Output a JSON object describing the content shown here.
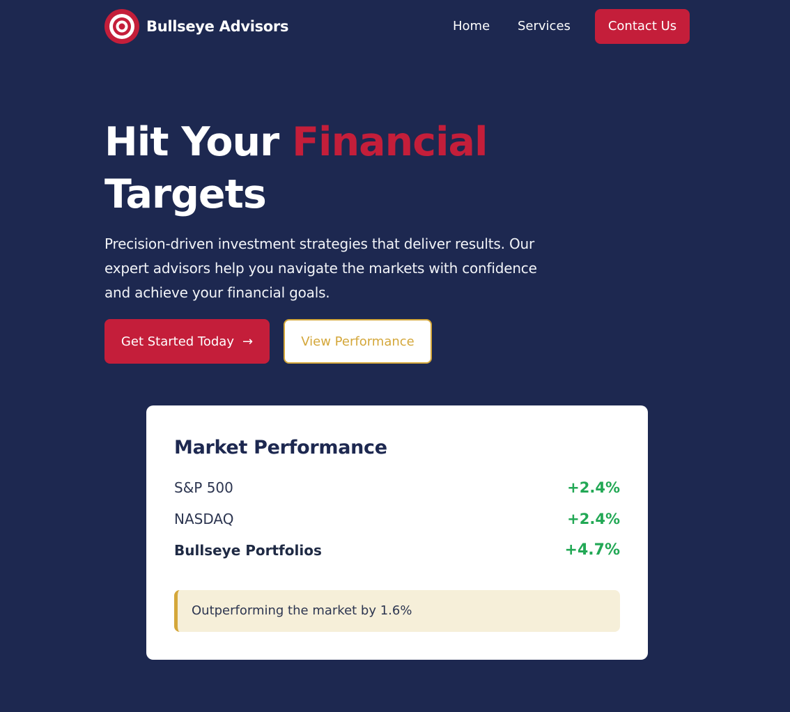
{
  "brand": {
    "name": "Bullseye Advisors",
    "logo_icon": "bullseye-target-icon"
  },
  "nav": {
    "links": [
      {
        "label": "Home"
      },
      {
        "label": "Services"
      }
    ],
    "contact_label": "Contact Us"
  },
  "hero": {
    "title_part1": "Hit Your",
    "title_accent": "Financial",
    "title_part2": "Targets",
    "description": "Precision-driven investment strategies that deliver results. Our expert advisors help you navigate the markets with confidence and achieve your financial goals.",
    "primary_cta": "Get Started Today",
    "primary_cta_icon": "arrow-right-icon",
    "secondary_cta": "View Performance"
  },
  "performance": {
    "title": "Market Performance",
    "rows": [
      {
        "label": "S&P 500",
        "value": "+2.4%"
      },
      {
        "label": "NASDAQ",
        "value": "+2.4%"
      },
      {
        "label": "Bullseye Portfolios",
        "value": "+4.7%"
      }
    ],
    "note": "Outperforming the market by 1.6%"
  },
  "colors": {
    "background": "#1d2850",
    "accent_red": "#c41e3a",
    "gold": "#d4a73a",
    "positive_green": "#22a855",
    "note_background": "#f6efd9"
  }
}
